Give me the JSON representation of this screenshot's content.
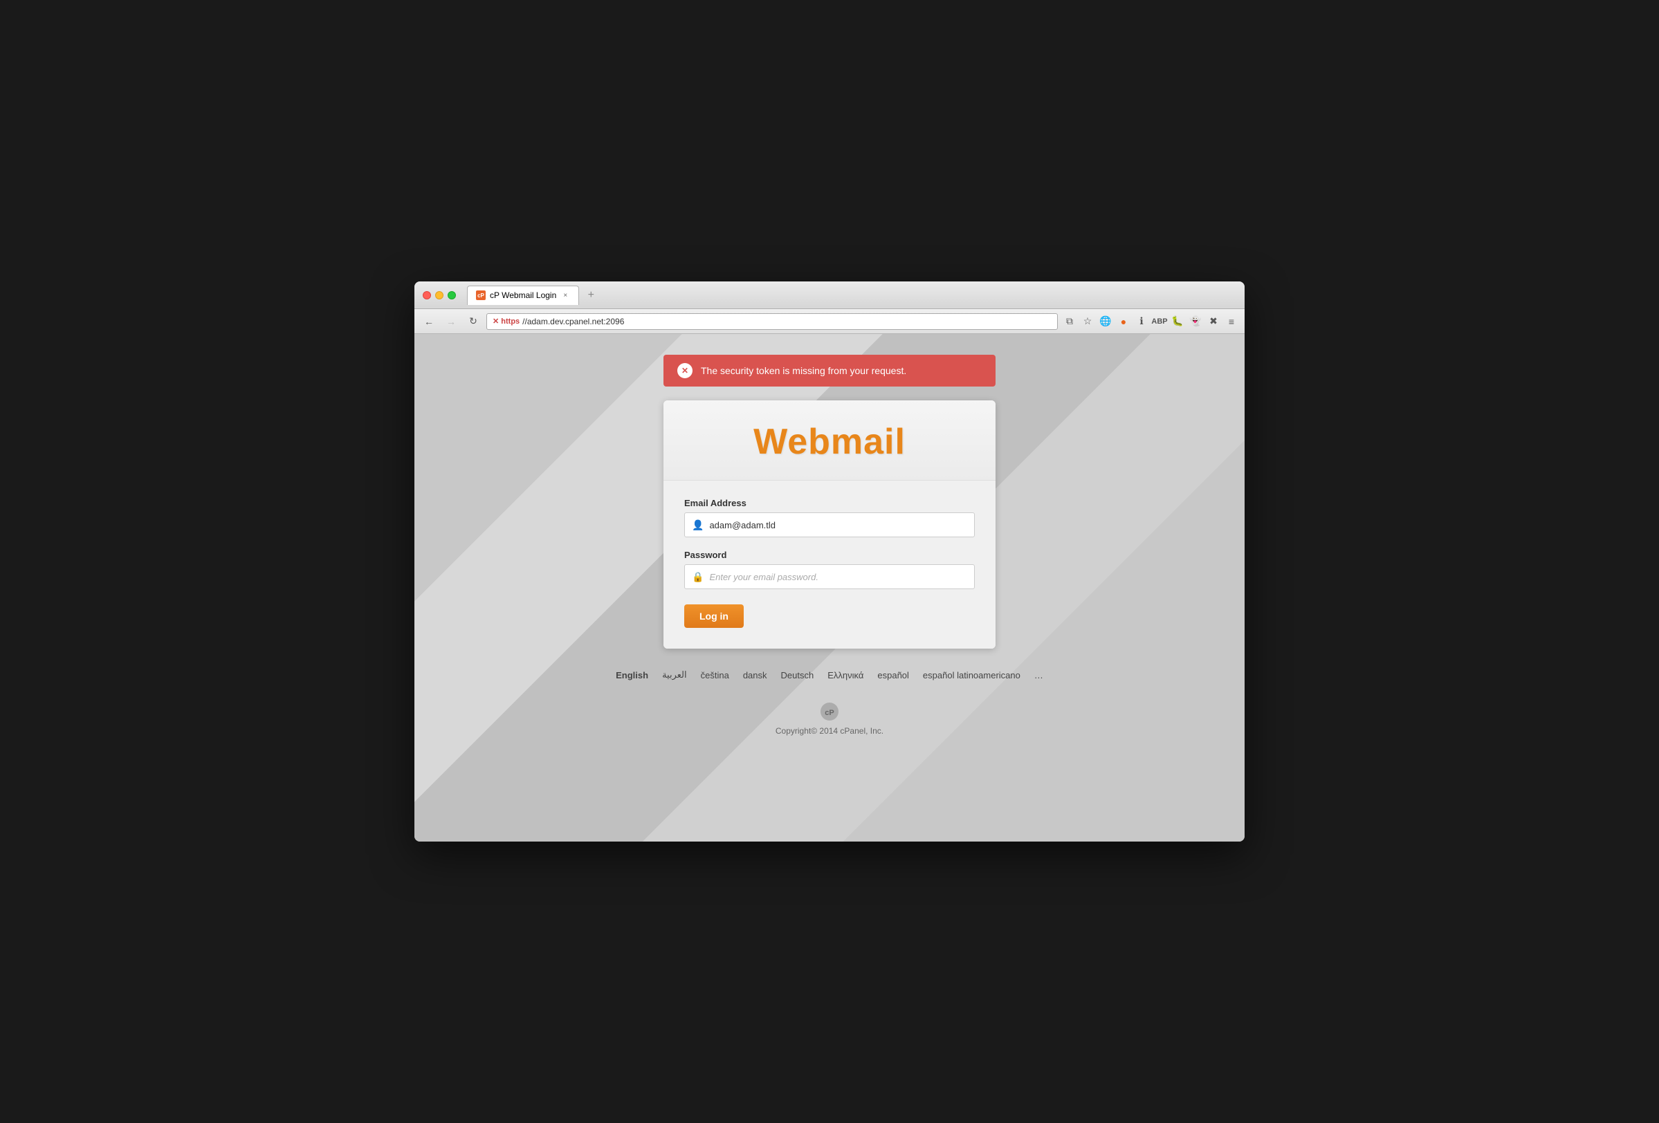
{
  "browser": {
    "tab_title": "cP Webmail Login",
    "address_bar": {
      "protocol": "https",
      "url": "https://adam.dev.cpanel.net:2096",
      "secure_label": "https",
      "display": "https://adam.dev.cpanel.net:2096"
    }
  },
  "alert": {
    "message": "The security token is missing from your request."
  },
  "login": {
    "title": "Webmail",
    "email_label": "Email Address",
    "email_value": "adam@adam.tld",
    "email_placeholder": "adam@adam.tld",
    "password_label": "Password",
    "password_placeholder": "Enter your email password.",
    "login_button": "Log in"
  },
  "languages": [
    {
      "code": "en",
      "label": "English",
      "active": true
    },
    {
      "code": "ar",
      "label": "العربية",
      "active": false
    },
    {
      "code": "cs",
      "label": "čeština",
      "active": false
    },
    {
      "code": "da",
      "label": "dansk",
      "active": false
    },
    {
      "code": "de",
      "label": "Deutsch",
      "active": false
    },
    {
      "code": "el",
      "label": "Ελληνικά",
      "active": false
    },
    {
      "code": "es",
      "label": "español",
      "active": false
    },
    {
      "code": "es_419",
      "label": "español latinoamericano",
      "active": false
    },
    {
      "code": "more",
      "label": "…",
      "active": false
    }
  ],
  "footer": {
    "copyright": "Copyright© 2014 cPanel, Inc."
  },
  "colors": {
    "accent": "#e8861a",
    "error": "#d9534f"
  }
}
